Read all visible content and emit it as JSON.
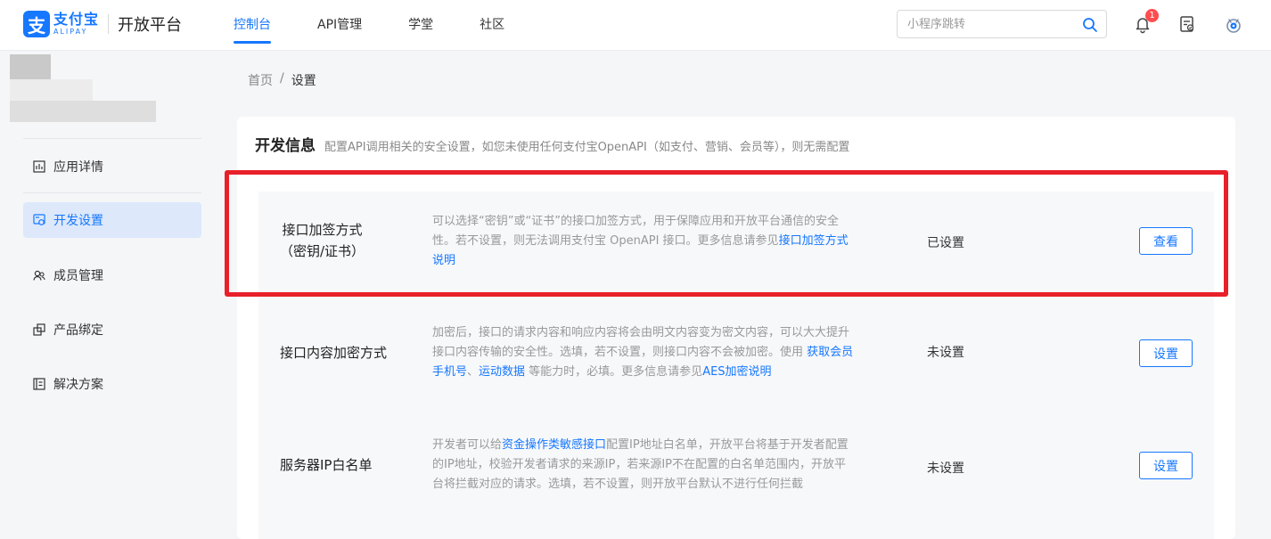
{
  "header": {
    "logo_cn": "支付宝",
    "logo_en": "ALIPAY",
    "logo_mark": "支",
    "platform": "开放平台",
    "nav": [
      {
        "label": "控制台",
        "active": true
      },
      {
        "label": "API管理",
        "active": false
      },
      {
        "label": "学堂",
        "active": false
      },
      {
        "label": "社区",
        "active": false
      }
    ],
    "search": {
      "placeholder": "小程序跳转",
      "value": ""
    },
    "notification_count": "1",
    "icons": [
      "search-icon",
      "bell-icon",
      "document-icon",
      "user-avatar-icon"
    ]
  },
  "sidebar": {
    "items": [
      {
        "label": "应用详情",
        "icon": "chart-icon",
        "active": false
      },
      {
        "label": "开发设置",
        "icon": "dev-settings-icon",
        "active": true
      },
      {
        "label": "成员管理",
        "icon": "members-icon",
        "active": false
      },
      {
        "label": "产品绑定",
        "icon": "product-bind-icon",
        "active": false
      },
      {
        "label": "解决方案",
        "icon": "solution-icon",
        "active": false
      }
    ]
  },
  "breadcrumb": {
    "home": "首页",
    "separator": "/",
    "current": "设置"
  },
  "card": {
    "title": "开发信息",
    "subtitle": "配置API调用相关的安全设置，如您未使用任何支付宝OpenAPI（如支付、营销、会员等），则无需配置",
    "rows": [
      {
        "name_line1": "接口加签方式",
        "name_line2": "（密钥/证书）",
        "desc_line1": "可以选择“密钥”或“证书”的接口加签方式，用于保障应用和开放平台通信的安全",
        "desc_line2": "性。若不设置，则无法调用支付宝 OpenAPI 接口。更多信息请参见",
        "desc_link1": "接口加签方式",
        "desc_link2": "说明",
        "status": "已设置",
        "button": "查看"
      },
      {
        "name_line1": "接口内容加密方式",
        "desc_line1": "加密后，接口的请求内容和响应内容将会由明文内容变为密文内容，可以大大提升",
        "desc_line2": "接口内容传输的安全性。选填，若不设置，则接口内容不会被加密。使用 ",
        "desc_link1": "获取会员",
        "desc_link2": "手机号",
        "desc_sep": "、",
        "desc_link3": "运动数据",
        "desc_mid": " 等能力时，必填。更多信息请参见",
        "desc_link4": "AES加密说明",
        "status": "未设置",
        "button": "设置"
      },
      {
        "name_line1": "服务器IP白名单",
        "desc_pre": "开发者可以给",
        "desc_link1": "资金操作类敏感接口",
        "desc_line1_rest": "配置IP地址白名单，开放平台将基于开发者配置",
        "desc_line2": "的IP地址，校验开发者请求的来源IP，若来源IP不在配置的白名单范围内，开放平",
        "desc_line3": "台将拦截对应的请求。选填，若不设置，则开放平台默认不进行任何拦截",
        "status": "未设置",
        "button": "设置"
      }
    ]
  },
  "colors": {
    "accent": "#1677ff",
    "highlight": "#e8202a",
    "badge": "#ff4d4f"
  }
}
